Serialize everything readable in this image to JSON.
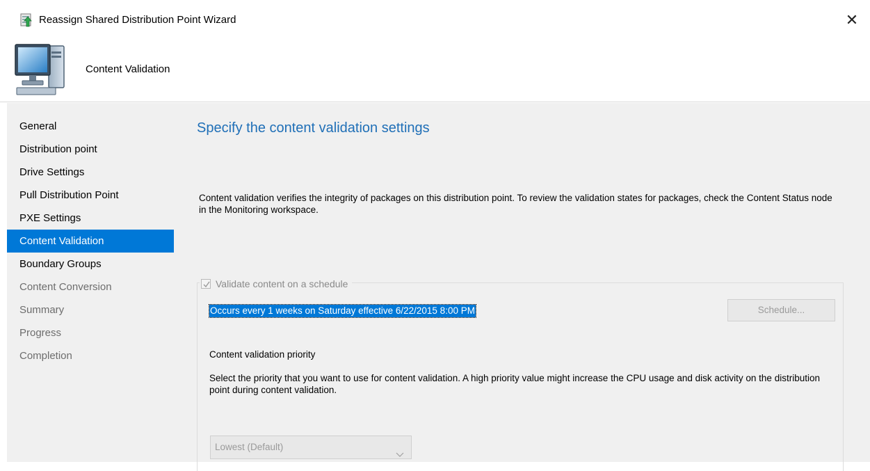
{
  "window": {
    "title": "Reassign Shared Distribution Point Wizard",
    "close_glyph": "✕"
  },
  "header": {
    "title": "Content Validation",
    "icon": "computer-icon"
  },
  "nav": {
    "items": [
      {
        "label": "General",
        "state": "enabled"
      },
      {
        "label": "Distribution point",
        "state": "enabled"
      },
      {
        "label": "Drive Settings",
        "state": "enabled"
      },
      {
        "label": "Pull Distribution Point",
        "state": "enabled"
      },
      {
        "label": "PXE Settings",
        "state": "enabled"
      },
      {
        "label": "Content Validation",
        "state": "selected"
      },
      {
        "label": "Boundary Groups",
        "state": "enabled"
      },
      {
        "label": "Content Conversion",
        "state": "disabled"
      },
      {
        "label": "Summary",
        "state": "disabled"
      },
      {
        "label": "Progress",
        "state": "disabled"
      },
      {
        "label": "Completion",
        "state": "disabled"
      }
    ]
  },
  "main": {
    "heading": "Specify the content validation settings",
    "description": "Content validation verifies the integrity of packages on this distribution point. To review the validation states for packages, check the Content Status node in the Monitoring workspace.",
    "validate_checkbox": {
      "label": "Validate content on a schedule",
      "checked": true,
      "enabled": false
    },
    "schedule_text": "Occurs every 1 weeks on Saturday effective 6/22/2015 8:00 PM",
    "schedule_button": "Schedule...",
    "priority_label": "Content validation priority",
    "priority_description": "Select the priority that you want to use for content validation. A high priority value might increase the CPU usage and disk activity on the distribution point during content validation.",
    "priority_select": {
      "value": "Lowest (Default)",
      "enabled": false
    }
  },
  "colors": {
    "accent": "#0078d7",
    "heading": "#1f6fb7",
    "panel_bg": "#f0f0f0",
    "disabled_text": "#6d6d6d"
  }
}
